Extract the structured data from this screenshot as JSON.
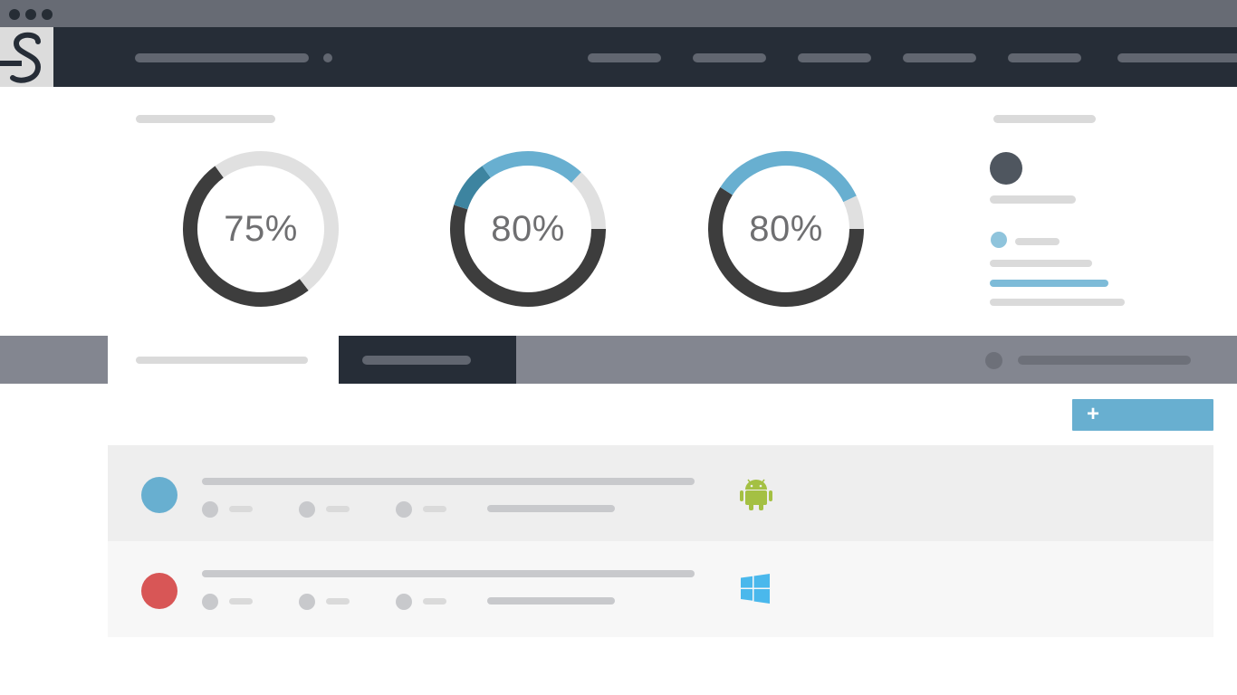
{
  "colors": {
    "chrome": "#676b74",
    "navbar": "#262d37",
    "accent_blue": "#68afd0",
    "dark_blue": "#3d84a0",
    "ring_dark": "#3d3d3d",
    "ring_track": "#e0e0e0",
    "android_green": "#a4c043",
    "windows_blue": "#4ab8ec",
    "avatar_blue": "#68afd0",
    "avatar_red": "#d85656"
  },
  "stats": [
    {
      "label": "75%",
      "value": 75,
      "segments": [
        {
          "color": "#3d3d3d",
          "start": 0.395,
          "end": 0.9
        },
        {
          "color": "#e0e0e0",
          "start": 0.9,
          "end": 1.395
        }
      ]
    },
    {
      "label": "80%",
      "value": 80,
      "segments": [
        {
          "color": "#3d3d3d",
          "start": 0.25,
          "end": 0.8
        },
        {
          "color": "#3d84a0",
          "start": 0.8,
          "end": 0.9
        },
        {
          "color": "#68afd0",
          "start": 0.9,
          "end": 1.12
        },
        {
          "color": "#e0e0e0",
          "start": 1.12,
          "end": 1.25
        }
      ]
    },
    {
      "label": "80%",
      "value": 80,
      "segments": [
        {
          "color": "#3d3d3d",
          "start": 0.25,
          "end": 0.84
        },
        {
          "color": "#68afd0",
          "start": 0.84,
          "end": 1.18
        },
        {
          "color": "#e0e0e0",
          "start": 1.18,
          "end": 1.25
        }
      ]
    }
  ],
  "devices": [
    {
      "avatar_color": "#d85656",
      "platform_icon": "windows-icon"
    },
    {
      "avatar_color": "#68afd0",
      "platform_icon": "android-icon"
    }
  ],
  "add_button": {
    "icon": "+"
  }
}
